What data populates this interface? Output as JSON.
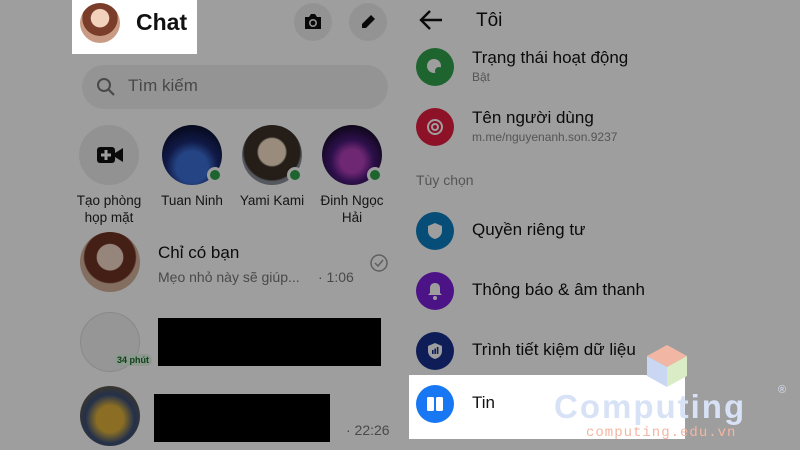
{
  "chat": {
    "title": "Chat",
    "search": {
      "placeholder": "Tìm kiếm"
    },
    "stories": [
      {
        "label": "Tạo phòng họp mặt"
      },
      {
        "label": "Tuan Ninh",
        "online": true
      },
      {
        "label": "Yami Kami",
        "online": true
      },
      {
        "label": "Đinh Ngọc Hải",
        "online": true
      }
    ],
    "conversations": [
      {
        "name": "Chỉ có bạn",
        "snippet": "Mẹo nhỏ này sẽ giúp...",
        "time": "· 1:06"
      },
      {
        "badge": "34 phút"
      },
      {
        "time": "· 22:26"
      }
    ]
  },
  "profile": {
    "title": "Tôi",
    "rows": [
      {
        "label": "Trạng thái hoạt động",
        "sub": "Bật",
        "icon": "active-status-icon",
        "color": "#31a24c"
      },
      {
        "label": "Tên người dùng",
        "sub": "m.me/nguyenanh.son.9237",
        "icon": "at-sign-icon",
        "color": "#e41e3f"
      }
    ],
    "section_label": "Tùy chọn",
    "options": [
      {
        "label": "Quyền riêng tư",
        "icon": "shield-icon",
        "color": "#0a7cc1"
      },
      {
        "label": "Thông báo & âm thanh",
        "icon": "bell-icon",
        "color": "#7b1fd8"
      },
      {
        "label": "Trình tiết kiệm dữ liệu",
        "icon": "data-saver-icon",
        "color": "#17308f"
      },
      {
        "label": "Tin",
        "icon": "stories-icon",
        "color": "#1877f2"
      }
    ]
  },
  "watermark": {
    "brand": "Computing",
    "url": "computing.edu.vn",
    "reg": "®"
  }
}
